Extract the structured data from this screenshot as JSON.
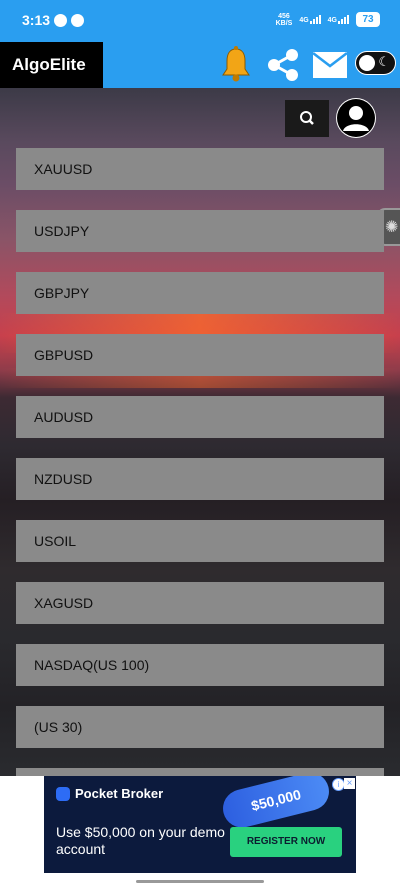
{
  "status_bar": {
    "time": "3:13",
    "net_speed_value": "456",
    "net_speed_unit": "KB/S",
    "signal1_label": "4G",
    "signal2_label": "4G",
    "battery": "73"
  },
  "app_bar": {
    "title": "AlgoElite",
    "icons": [
      "bell-icon",
      "share-icon",
      "mail-icon",
      "theme-toggle"
    ]
  },
  "symbols": [
    "XAUUSD",
    "USDJPY",
    "GBPJPY",
    "GBPUSD",
    "AUDUSD",
    "NZDUSD",
    "USOIL",
    "XAGUSD",
    "NASDAQ(US 100)",
    "(US 30)"
  ],
  "ad": {
    "brand": "Pocket Broker",
    "amount": "$50,000",
    "headline": "Use $50,000 on your demo account",
    "cta": "REGISTER NOW",
    "info": "i",
    "close": "×"
  },
  "colors": {
    "app_bar": "#2a9ef0",
    "list_item": "#8a8a8a",
    "ad_background": "#0c1a3d",
    "ad_cta": "#29d17f"
  }
}
